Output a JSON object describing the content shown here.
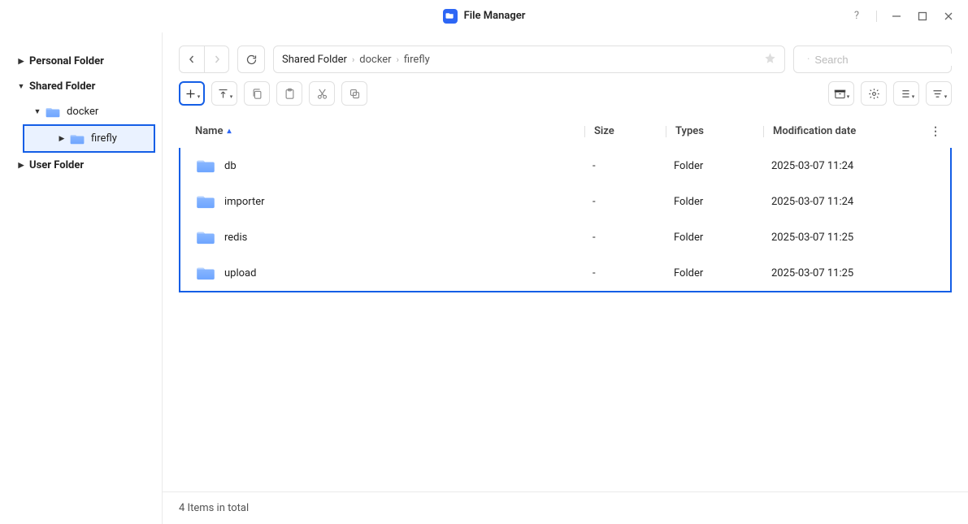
{
  "app": {
    "title": "File Manager"
  },
  "sidebar": {
    "personal": "Personal Folder",
    "shared": "Shared Folder",
    "docker": "docker",
    "firefly": "firefly",
    "user": "User Folder"
  },
  "breadcrumb": {
    "parts": [
      "Shared Folder",
      "docker",
      "firefly"
    ]
  },
  "search": {
    "placeholder": "Search"
  },
  "columns": {
    "name": "Name",
    "size": "Size",
    "types": "Types",
    "modification": "Modification date"
  },
  "rows": [
    {
      "name": "db",
      "size": "-",
      "type": "Folder",
      "date": "2025-03-07 11:24"
    },
    {
      "name": "importer",
      "size": "-",
      "type": "Folder",
      "date": "2025-03-07 11:24"
    },
    {
      "name": "redis",
      "size": "-",
      "type": "Folder",
      "date": "2025-03-07 11:25"
    },
    {
      "name": "upload",
      "size": "-",
      "type": "Folder",
      "date": "2025-03-07 11:25"
    }
  ],
  "status": "4 Items in total"
}
